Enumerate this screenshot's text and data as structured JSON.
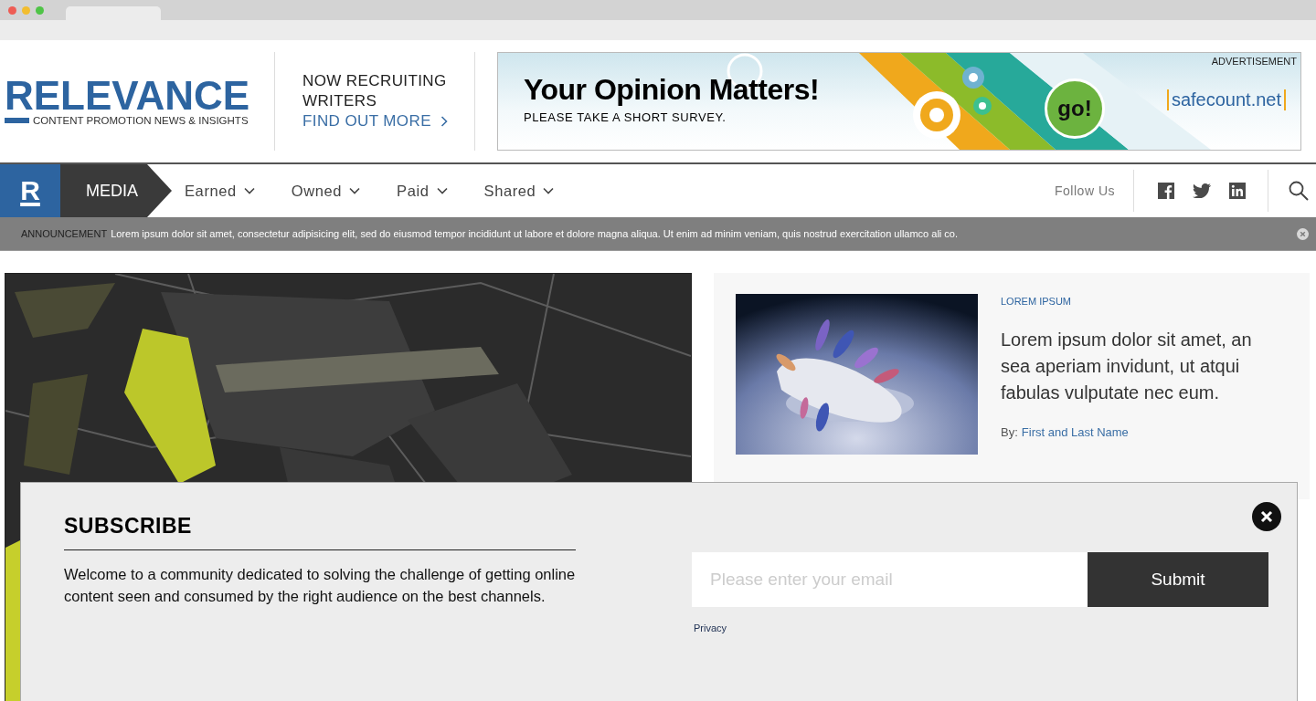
{
  "header": {
    "logo": {
      "title": "RELEVANCE",
      "tagline": "CONTENT PROMOTION NEWS & INSIGHTS"
    },
    "promo": {
      "lines": [
        "NOW RECRUITING",
        "WRITERS"
      ],
      "link": "FIND OUT MORE"
    },
    "ad": {
      "label": "ADVERTISEMENT",
      "headline": "Your Opinion Matters!",
      "subline": "PLEASE TAKE A SHORT SURVEY.",
      "button": "go!",
      "brand": "safecount.net"
    }
  },
  "nav": {
    "brand_letter": "R",
    "section": "MEDIA",
    "items": [
      {
        "label": "Earned"
      },
      {
        "label": "Owned"
      },
      {
        "label": "Paid"
      },
      {
        "label": "Shared"
      }
    ],
    "follow": "Follow Us"
  },
  "announcement": {
    "label": "ANNOUNCEMENT",
    "text": "Lorem ipsum dolor sit amet, consectetur adipisicing elit, sed do eiusmod tempor incididunt ut labore et dolore magna aliqua. Ut enim ad minim veniam, quis nostrud exercitation ullamco ali co."
  },
  "feature": {
    "category": "LOREM IPSUM",
    "headline": "Lorem ipsum dolor sit amet, an sea aperiam invidunt, ut atqui fabulas vulputate nec eum.",
    "byline_prefix": "By:",
    "author": "First and Last Name"
  },
  "subscribe": {
    "title": "SUBSCRIBE",
    "text": "Welcome to a community dedicated to solving the challenge of getting online content seen and consumed by the right audience on the best channels.",
    "placeholder": "Please enter your email",
    "submit": "Submit",
    "privacy": "Privacy"
  }
}
